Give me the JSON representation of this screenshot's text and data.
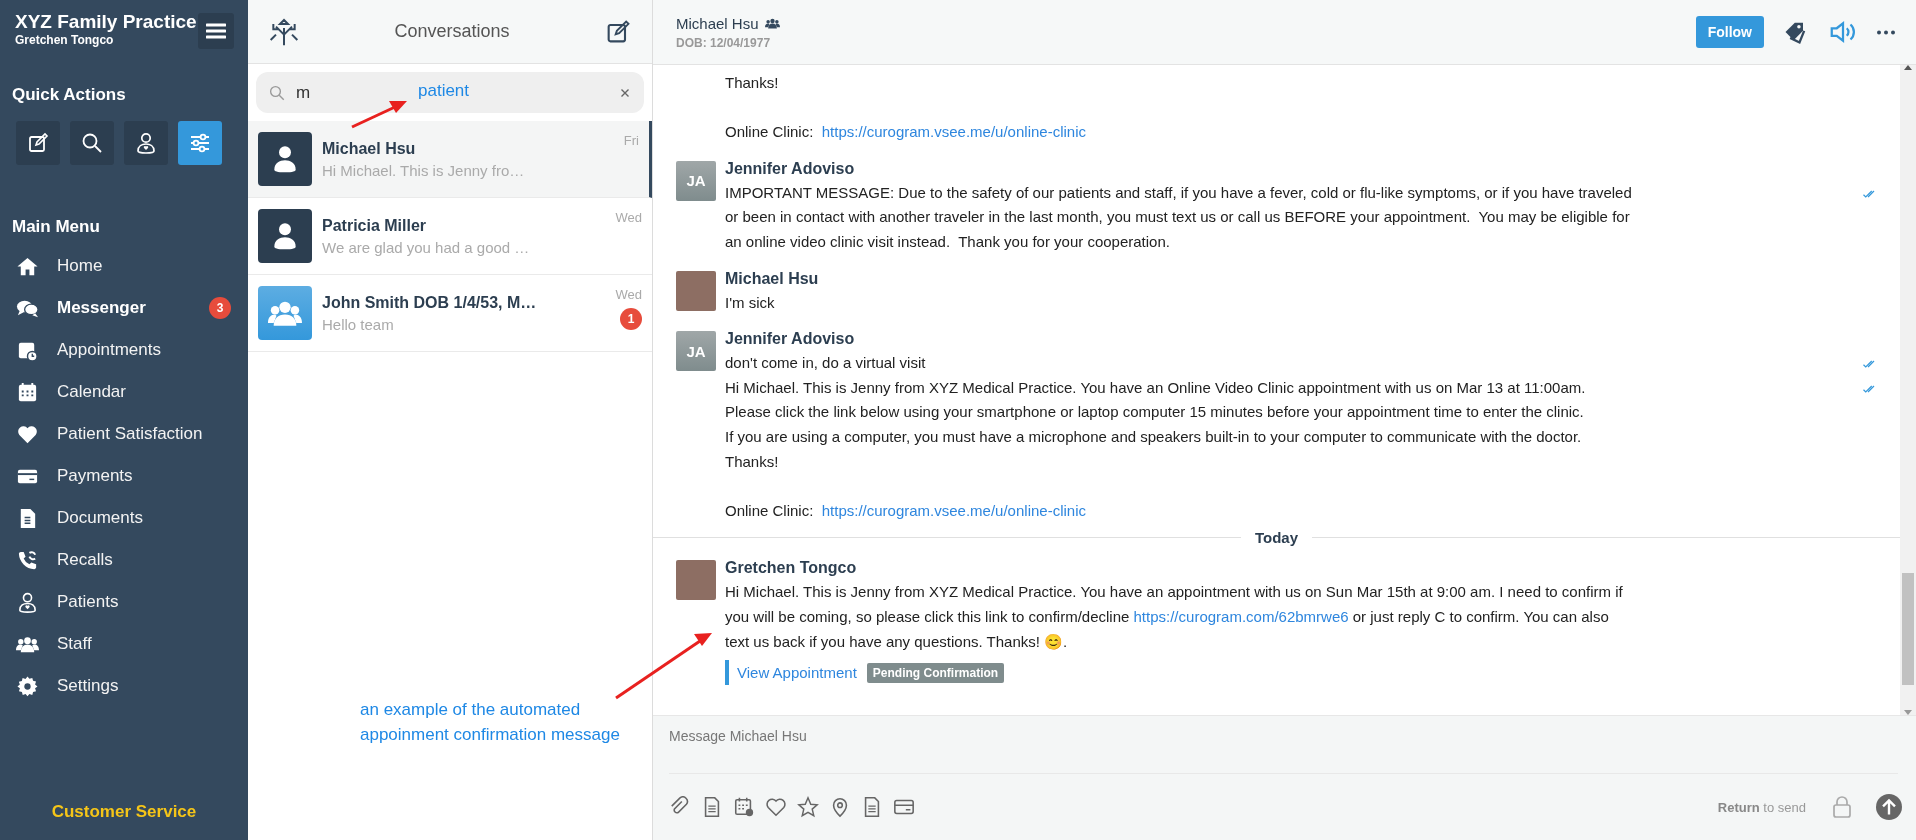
{
  "sidebar": {
    "title": "XYZ Family Practice",
    "user": "Gretchen Tongco",
    "quick_actions_heading": "Quick Actions",
    "quick_actions": [
      {
        "kind": "compose",
        "selected": false
      },
      {
        "kind": "search",
        "selected": false
      },
      {
        "kind": "patient",
        "selected": false
      },
      {
        "kind": "filters",
        "selected": true
      }
    ],
    "main_menu_heading": "Main Menu",
    "menu": [
      {
        "kind": "home",
        "label": "Home",
        "selected": false
      },
      {
        "kind": "chat",
        "label": "Messenger",
        "selected": true,
        "badge": "3"
      },
      {
        "kind": "appointments",
        "label": "Appointments",
        "selected": false
      },
      {
        "kind": "calendar",
        "label": "Calendar",
        "selected": false
      },
      {
        "kind": "heart",
        "label": "Patient Satisfaction",
        "selected": false
      },
      {
        "kind": "card",
        "label": "Payments",
        "selected": false
      },
      {
        "kind": "document",
        "label": "Documents",
        "selected": false
      },
      {
        "kind": "recall",
        "label": "Recalls",
        "selected": false
      },
      {
        "kind": "patient",
        "label": "Patients",
        "selected": false
      },
      {
        "kind": "staff",
        "label": "Staff",
        "selected": false
      },
      {
        "kind": "settings",
        "label": "Settings",
        "selected": false
      }
    ],
    "footer_link": "Customer Service"
  },
  "conversations": {
    "title": "Conversations",
    "search": {
      "value": "m"
    },
    "items": [
      {
        "kind": "patient",
        "name": "Michael Hsu",
        "preview": "Hi Michael. This is Jenny fro…",
        "time": "Fri",
        "selected": true
      },
      {
        "kind": "patient",
        "name": "Patricia Miller",
        "preview": "We are glad you had a good …",
        "time": "Wed",
        "selected": false
      },
      {
        "kind": "group",
        "name": "John Smith DOB 1/4/53, M…",
        "preview": "Hello team",
        "time": "Wed",
        "selected": false,
        "badge": "1"
      }
    ]
  },
  "chat": {
    "header": {
      "name": "Michael Hsu",
      "dob": "DOB: 12/04/1977",
      "follow": "Follow"
    },
    "timeline": [
      {
        "kind": "continuation",
        "messages": [
          {
            "delivered": false,
            "parts": [
              {
                "kind": "text",
                "text": "Thanks!\n\nOnline Clinic:  "
              },
              {
                "kind": "link",
                "text": "https://curogram.vsee.me/u/online-clinic"
              }
            ]
          }
        ]
      },
      {
        "kind": "group",
        "sender": "Jennifer Adoviso",
        "avatar": {
          "kind": "initials",
          "text": "JA"
        },
        "messages": [
          {
            "delivered": true,
            "parts": [
              {
                "kind": "text",
                "text": "IMPORTANT MESSAGE: Due to the safety of our patients and staff, if you have a fever, cold or flu-like symptoms, or if you have traveled or been in contact with another traveler in the last month, you must text us or call us BEFORE your appointment.  You may be eligible for an online video clinic visit instead.  Thank you for your cooperation."
              }
            ]
          }
        ]
      },
      {
        "kind": "group",
        "sender": "Michael Hsu",
        "avatar": {
          "kind": "photo"
        },
        "messages": [
          {
            "delivered": false,
            "parts": [
              {
                "kind": "text",
                "text": "I'm sick"
              }
            ]
          }
        ]
      },
      {
        "kind": "group",
        "sender": "Jennifer Adoviso",
        "avatar": {
          "kind": "initials",
          "text": "JA"
        },
        "messages": [
          {
            "delivered": true,
            "parts": [
              {
                "kind": "text",
                "text": "don't come in, do a virtual visit"
              }
            ]
          },
          {
            "delivered": true,
            "parts": [
              {
                "kind": "text",
                "text": "Hi Michael. This is Jenny from XYZ Medical Practice. You have an Online Video Clinic appointment with us on Mar 13 at 11:00am.\nPlease click the link below using your smartphone or laptop computer 15 minutes before your appointment time to enter the clinic.\nIf you are using a computer, you must have a microphone and speakers built-in to your computer to communicate with the doctor.\nThanks!\n\nOnline Clinic:  "
              },
              {
                "kind": "link",
                "text": "https://curogram.vsee.me/u/online-clinic"
              }
            ]
          }
        ]
      },
      {
        "kind": "divider",
        "label": "Today"
      },
      {
        "kind": "group",
        "sender": "Gretchen Tongco",
        "avatar": {
          "kind": "photo"
        },
        "messages": [
          {
            "delivered": false,
            "parts": [
              {
                "kind": "text",
                "text": "Hi Michael. This is Jenny from XYZ Medical Practice. You have an appointment with us on Sun Mar 15th at 9:00 am. I need to confirm if you will be coming, so please click this link to confirm/decline "
              },
              {
                "kind": "link",
                "text": "https://curogram.com/62bmrwe6"
              },
              {
                "kind": "text",
                "text": " or just reply C to confirm. You can also text us back if you have any questions. Thanks! 😊."
              }
            ],
            "action": {
              "link": "View Appointment",
              "status": "Pending Confirmation"
            }
          }
        ]
      }
    ],
    "composer": {
      "placeholder": "Message Michael Hsu",
      "hint_key": "Return",
      "hint_rest": "to send"
    }
  },
  "annotations": [
    {
      "text": "patient"
    },
    {
      "text": "an example of the automated appoinment confirmation message"
    }
  ]
}
